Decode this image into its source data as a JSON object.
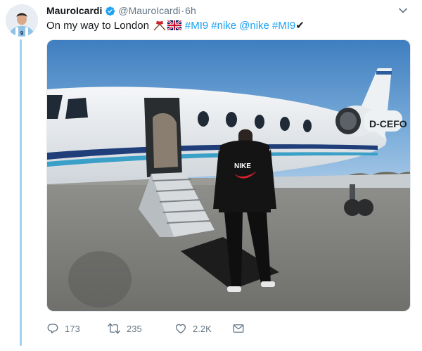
{
  "tweet": {
    "display_name": "MauroIcardi",
    "handle": "@MauroIcardi",
    "separator": "·",
    "time": "6h",
    "text_prefix": "On my way to London",
    "hashtags": [
      "#MI9",
      "#nike",
      "@nike",
      "#MI9"
    ],
    "text_suffix_glyph": "✔",
    "emoji_icons": [
      "crossed-flags-icon",
      "uk-flag-icon"
    ],
    "media_alt_texts": {
      "aircraft_registration": "D-CEFO",
      "jacket_brand": "NIKE"
    },
    "colors": {
      "link_blue": "#1da1f2",
      "muted_gray": "#657786",
      "verified_blue": "#1da1f2",
      "thread_line": "#9fd3f1"
    }
  },
  "actions": {
    "reply_count": "173",
    "retweet_count": "235",
    "like_count": "2.2K"
  }
}
